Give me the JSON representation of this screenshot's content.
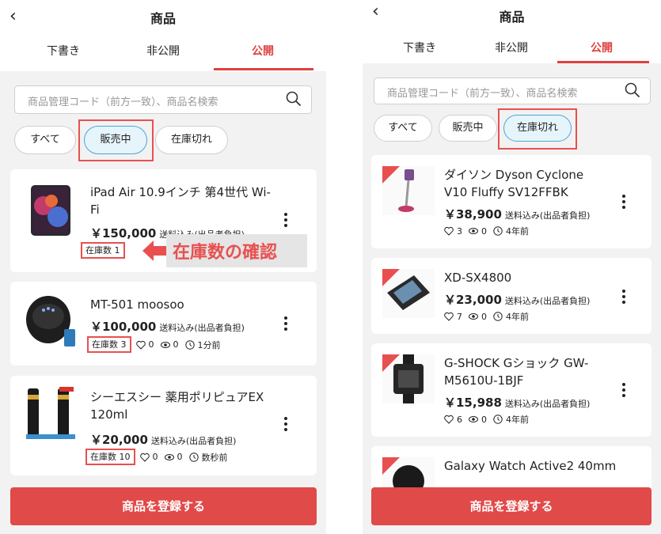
{
  "left": {
    "header": {
      "title": "商品"
    },
    "tabs": [
      "下書き",
      "非公開",
      "公開"
    ],
    "search": {
      "placeholder": "商品管理コード（前方一致）、商品名検索"
    },
    "filters": [
      "すべて",
      "販売中",
      "在庫切れ"
    ],
    "items": [
      {
        "name": "iPad Air 10.9インチ 第4世代 Wi-Fi",
        "price": "￥150,000",
        "shipping": "送料込み(出品者負担)",
        "stock": "在庫数 1"
      },
      {
        "name": "MT-501 moosoo",
        "price": "￥100,000",
        "shipping": "送料込み(出品者負担)",
        "stock": "在庫数 3",
        "likes": "0",
        "views": "0",
        "time": "1分前"
      },
      {
        "name": "シーエスシー 薬用ポリピュアEX 120ml",
        "price": "￥20,000",
        "shipping": "送料込み(出品者負担)",
        "stock": "在庫数 10",
        "likes": "0",
        "views": "0",
        "time": "数秒前"
      }
    ],
    "callout": "在庫数の確認",
    "cta": "商品を登録する"
  },
  "right": {
    "header": {
      "title": "商品"
    },
    "tabs": [
      "下書き",
      "非公開",
      "公開"
    ],
    "search": {
      "placeholder": "商品管理コード（前方一致）、商品名検索"
    },
    "filters": [
      "すべて",
      "販売中",
      "在庫切れ"
    ],
    "items": [
      {
        "name": "ダイソン Dyson Cyclone V10 Fluffy SV12FFBK",
        "price": "￥38,900",
        "shipping": "送料込み(出品者負担)",
        "likes": "3",
        "views": "0",
        "time": "4年前"
      },
      {
        "name": "XD-SX4800",
        "price": "￥23,000",
        "shipping": "送料込み(出品者負担)",
        "likes": "7",
        "views": "0",
        "time": "4年前"
      },
      {
        "name": "G-SHOCK Gショック GW-M5610U-1BJF",
        "price": "￥15,988",
        "shipping": "送料込み(出品者負担)",
        "likes": "6",
        "views": "0",
        "time": "4年前"
      },
      {
        "name": "Galaxy Watch Active2 40mm"
      }
    ],
    "cta": "商品を登録する"
  },
  "colors": {
    "accent": "#e04a48",
    "highlight": "#e8504f",
    "chip_selected_bg": "#e6f4fb"
  }
}
